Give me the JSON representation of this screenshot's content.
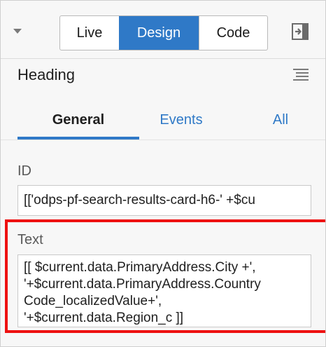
{
  "toolbar": {
    "collapse_icon": "triangle-down-icon",
    "modes": [
      "Live",
      "Design",
      "Code"
    ],
    "active_mode": "Design",
    "panel_icon": "panel-collapse-icon"
  },
  "component": {
    "title": "Heading",
    "menu_icon": "hamburger-menu-icon"
  },
  "tabs": {
    "items": [
      "General",
      "Events",
      "All"
    ],
    "active": "General"
  },
  "fields": {
    "id": {
      "label": "ID",
      "value": "[['odps-pf-search-results-card-h6-' +$cu"
    },
    "text": {
      "label": "Text",
      "lines": [
        "[[ $current.data.PrimaryAddress.City +',",
        "'+$current.data.PrimaryAddress.Country",
        "Code_localizedValue+',",
        "'+$current.data.Region_c ]]"
      ]
    }
  },
  "colors": {
    "accent": "#2f79c7",
    "highlight": "#ee1111"
  }
}
